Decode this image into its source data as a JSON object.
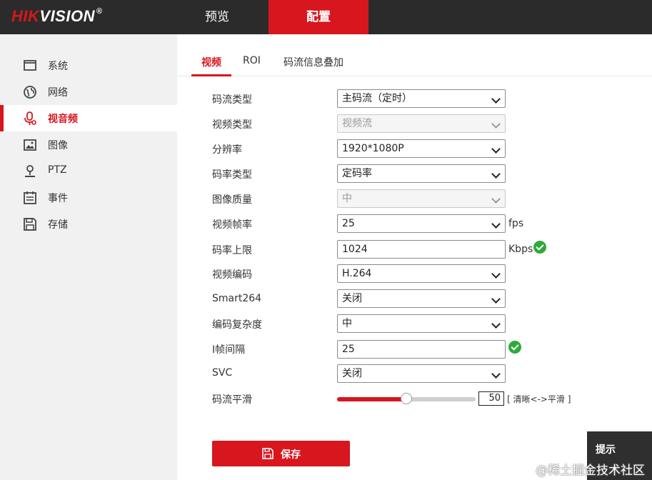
{
  "brand": {
    "logo_prefix": "HIK",
    "logo_suffix": "VISION",
    "logo_reg": "®"
  },
  "topnav": {
    "preview": "预览",
    "config": "配置"
  },
  "sidebar": {
    "items": [
      {
        "label": "系统",
        "icon": "monitor-icon"
      },
      {
        "label": "网络",
        "icon": "globe-icon"
      },
      {
        "label": "视音频",
        "icon": "microphone-icon",
        "active": true
      },
      {
        "label": "图像",
        "icon": "image-icon"
      },
      {
        "label": "PTZ",
        "icon": "ptz-icon"
      },
      {
        "label": "事件",
        "icon": "calendar-icon"
      },
      {
        "label": "存储",
        "icon": "floppy-icon"
      }
    ]
  },
  "tabs": [
    {
      "label": "视频",
      "active": true
    },
    {
      "label": "ROI"
    },
    {
      "label": "码流信息叠加"
    }
  ],
  "form": {
    "stream_type": {
      "label": "码流类型",
      "value": "主码流（定时）"
    },
    "video_type": {
      "label": "视频类型",
      "value": "视频流",
      "disabled": true
    },
    "resolution": {
      "label": "分辨率",
      "value": "1920*1080P"
    },
    "bitrate_type": {
      "label": "码率类型",
      "value": "定码率"
    },
    "image_quality": {
      "label": "图像质量",
      "value": "中",
      "disabled": true
    },
    "frame_rate": {
      "label": "视频帧率",
      "value": "25",
      "unit": "fps"
    },
    "max_bitrate": {
      "label": "码率上限",
      "value": "1024",
      "unit": "Kbps"
    },
    "video_encoding": {
      "label": "视频编码",
      "value": "H.264"
    },
    "smart264": {
      "label": "Smart264",
      "value": "关闭"
    },
    "encoding_complexity": {
      "label": "编码复杂度",
      "value": "中"
    },
    "i_frame_interval": {
      "label": "I帧间隔",
      "value": "25"
    },
    "svc": {
      "label": "SVC",
      "value": "关闭"
    },
    "stream_smoothing": {
      "label": "码流平滑",
      "value": "50",
      "level_percent": 50,
      "hint": "[ 清晰<->平滑 ]"
    }
  },
  "save_button": {
    "label": "保存"
  },
  "tip": {
    "label": "提示"
  },
  "watermark": {
    "text": "@稀土掘金技术社区"
  },
  "colors": {
    "accent": "#d7161e",
    "topbar": "#2b2b2b",
    "sidebar": "#f1f1f1",
    "ok": "#2faa3a"
  }
}
